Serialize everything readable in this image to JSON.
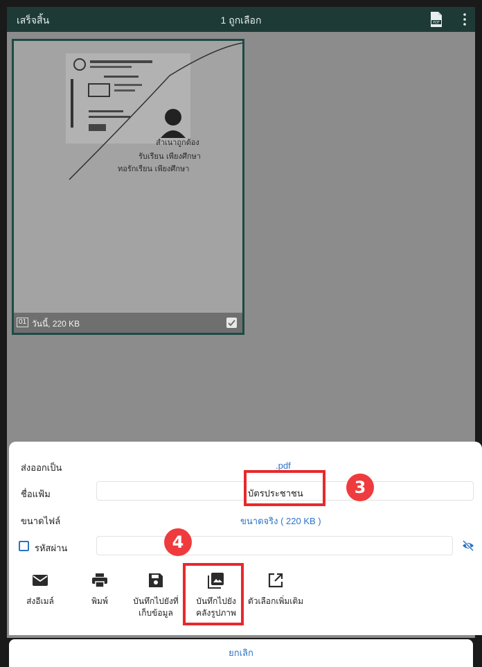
{
  "topbar": {
    "done_label": "เสร็จสิ้น",
    "selected_count": "1 ถูกเลือก",
    "pdf_icon": "pdf-file-icon",
    "more_icon": "more-vert-icon"
  },
  "thumbnail": {
    "index": "01",
    "info": "วันนี้, 220 KB",
    "checked": true
  },
  "export": {
    "format_label": "ส่งออกเป็น",
    "format_value": ".pdf",
    "filename_label": "ชื่อแฟ้ม",
    "filename_value": "บัตรประชาชน",
    "filesize_label": "ขนาดไฟล์",
    "filesize_value": "ขนาดจริง ( 220 KB )",
    "password_label": "รหัสผ่าน",
    "password_value": ""
  },
  "actions": [
    {
      "icon": "mail-icon",
      "line1": "ส่งอีเมล์",
      "line2": ""
    },
    {
      "icon": "print-icon",
      "line1": "พิมพ์",
      "line2": ""
    },
    {
      "icon": "save-icon",
      "line1": "บันทึกไปยังที่",
      "line2": "เก็บข้อมูล"
    },
    {
      "icon": "gallery-icon",
      "line1": "บันทึกไปยัง",
      "line2": "คลังรูปภาพ"
    },
    {
      "icon": "external-link-icon",
      "line1": "ตัวเลือกเพิ่มเติม",
      "line2": ""
    }
  ],
  "annotations": {
    "step3": "3",
    "step4": "4"
  },
  "cancel_label": "ยกเลิก",
  "colors": {
    "topbar": "#1e3a36",
    "accent": "#2a73c6",
    "annotation": "#e8292b"
  }
}
